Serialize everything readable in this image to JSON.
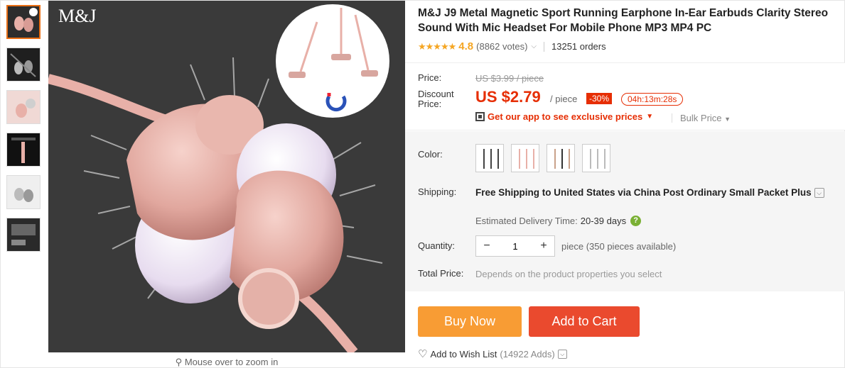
{
  "product": {
    "title": "M&J J9 Metal Magnetic Sport Running Earphone In-Ear Earbuds Clarity Stereo Sound With Mic Headset For Mobile Phone MP3 MP4 PC",
    "brand_logo": "M&J",
    "stars": "★★★★★",
    "rating": "4.8",
    "votes": "(8862 votes)",
    "orders": "13251 orders"
  },
  "gallery": {
    "zoom_hint": "Mouse over to zoom in",
    "thumb_count": 6
  },
  "price": {
    "price_label": "Price:",
    "original": "US $3.99 / piece",
    "discount_label": "Discount Price:",
    "current": "US $2.79",
    "unit": "/ piece",
    "discount": "-30%",
    "timer": "04h:13m:28s",
    "app_promo": "Get our app to see exclusive prices",
    "bulk": "Bulk Price"
  },
  "options": {
    "color_label": "Color:",
    "shipping_label": "Shipping:",
    "shipping_text": "Free Shipping to United States via China Post Ordinary Small Packet Plus",
    "est_label": "Estimated Delivery Time:",
    "est_value": "20-39 days",
    "quantity_label": "Quantity:",
    "quantity_value": "1",
    "quantity_note": "piece (350 pieces available)",
    "total_label": "Total Price:",
    "total_note": "Depends on the product properties you select"
  },
  "actions": {
    "buy_now": "Buy Now",
    "add_to_cart": "Add to Cart",
    "wish_list": "Add to Wish List",
    "wish_count": "(14922 Adds)"
  },
  "colors": {
    "accent_red": "#e62e04",
    "buy_orange": "#f89c34",
    "cart_red": "#ea4a2e",
    "star": "#f5a623",
    "rose_gold": "#e8b0a8"
  }
}
